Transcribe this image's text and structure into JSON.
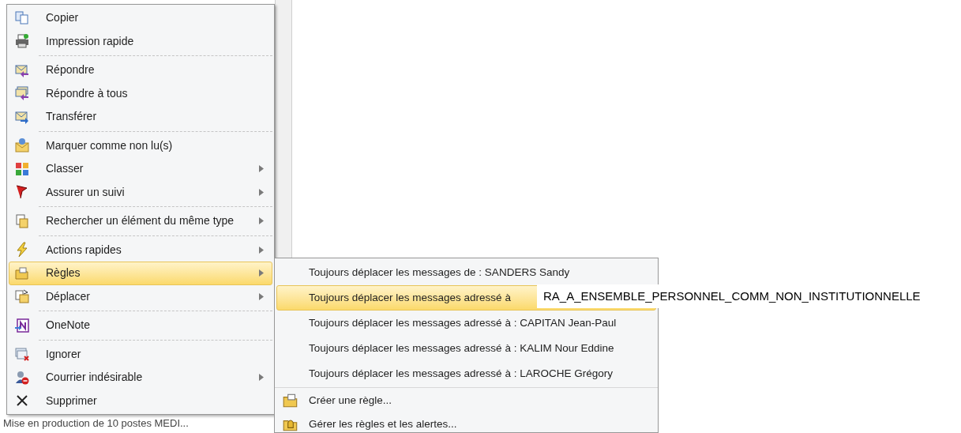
{
  "background": {
    "message_preview": "Mise en production de 10 postes MEDI..."
  },
  "context_menu": {
    "items": [
      {
        "kind": "item",
        "label": "Copier",
        "submenu": false,
        "selected": false
      },
      {
        "kind": "item",
        "label": "Impression rapide",
        "submenu": false,
        "selected": false
      },
      {
        "kind": "separator"
      },
      {
        "kind": "item",
        "label": "Répondre",
        "submenu": false,
        "selected": false
      },
      {
        "kind": "item",
        "label": "Répondre à tous",
        "submenu": false,
        "selected": false
      },
      {
        "kind": "item",
        "label": "Transférer",
        "submenu": false,
        "selected": false
      },
      {
        "kind": "separator"
      },
      {
        "kind": "item",
        "label": "Marquer comme non lu(s)",
        "submenu": false,
        "selected": false
      },
      {
        "kind": "item",
        "label": "Classer",
        "submenu": true,
        "selected": false
      },
      {
        "kind": "item",
        "label": "Assurer un suivi",
        "submenu": true,
        "selected": false
      },
      {
        "kind": "separator"
      },
      {
        "kind": "item",
        "label": "Rechercher un élément du même type",
        "submenu": true,
        "selected": false
      },
      {
        "kind": "separator"
      },
      {
        "kind": "item",
        "label": "Actions rapides",
        "submenu": true,
        "selected": false
      },
      {
        "kind": "item",
        "label": "Règles",
        "submenu": true,
        "selected": true
      },
      {
        "kind": "item",
        "label": "Déplacer",
        "submenu": true,
        "selected": false
      },
      {
        "kind": "separator"
      },
      {
        "kind": "item",
        "label": "OneNote",
        "submenu": false,
        "selected": false
      },
      {
        "kind": "separator"
      },
      {
        "kind": "item",
        "label": "Ignorer",
        "submenu": false,
        "selected": false
      },
      {
        "kind": "item",
        "label": "Courrier indésirable",
        "submenu": true,
        "selected": false
      },
      {
        "kind": "item",
        "label": "Supprimer",
        "submenu": false,
        "selected": false
      }
    ]
  },
  "submenu": {
    "items": [
      {
        "kind": "item",
        "label": "Toujours déplacer les messages de : SANDERS Sandy",
        "selected": false
      },
      {
        "kind": "item",
        "label": "Toujours déplacer les messages adressé à",
        "selected": true
      },
      {
        "kind": "item",
        "label": "Toujours déplacer les messages adressé à : CAPITAN Jean-Paul",
        "selected": false
      },
      {
        "kind": "item",
        "label": "Toujours déplacer les messages adressé à : KALIM Nour Eddine",
        "selected": false
      },
      {
        "kind": "item",
        "label": "Toujours déplacer les messages adressé à : LAROCHE Grégory",
        "selected": false
      },
      {
        "kind": "separator"
      },
      {
        "kind": "icon_item",
        "label": "Créer une règle...",
        "selected": false
      },
      {
        "kind": "icon_item",
        "label": "Gérer les règles et les alertes...",
        "selected": false
      }
    ]
  },
  "tooltip": {
    "text": "RA_A_ENSEMBLE_PERSONNEL_COMM_NON_INSTITUTIONNELLE"
  }
}
